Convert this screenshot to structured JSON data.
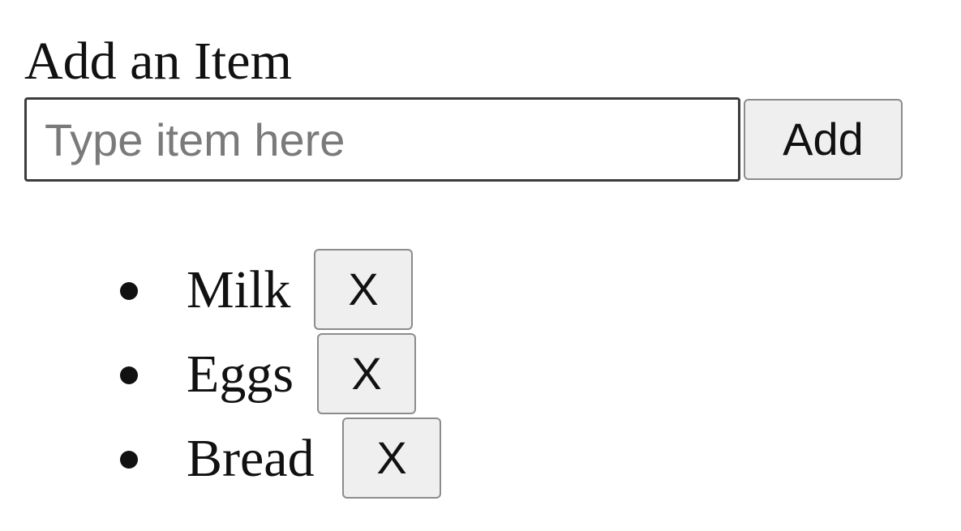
{
  "form": {
    "label": "Add an Item",
    "input_placeholder": "Type item here",
    "input_value": "",
    "add_button_label": "Add"
  },
  "list": {
    "items": [
      {
        "text": "Milk",
        "remove_label": "X"
      },
      {
        "text": "Eggs",
        "remove_label": "X"
      },
      {
        "text": "Bread",
        "remove_label": "X"
      }
    ]
  },
  "icons": {
    "bullet": "bullet-dot-icon"
  }
}
